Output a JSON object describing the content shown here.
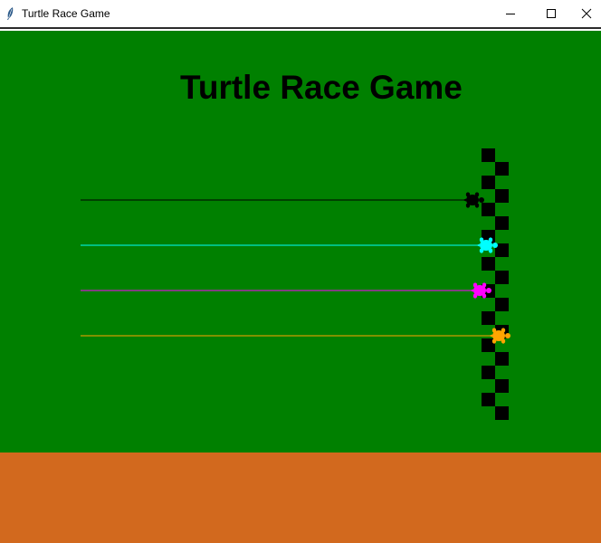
{
  "window": {
    "title": "Turtle Race Game",
    "controls": [
      "minimize",
      "maximize",
      "close"
    ]
  },
  "game": {
    "title": "Turtle Race Game",
    "colors": {
      "field": "#008000",
      "ground": "#d2691e",
      "finish_line": "#000000"
    },
    "turtles": [
      {
        "color": "#000000"
      },
      {
        "color": "#00ffff"
      },
      {
        "color": "#ff00ff"
      },
      {
        "color": "#ffa500"
      }
    ]
  }
}
